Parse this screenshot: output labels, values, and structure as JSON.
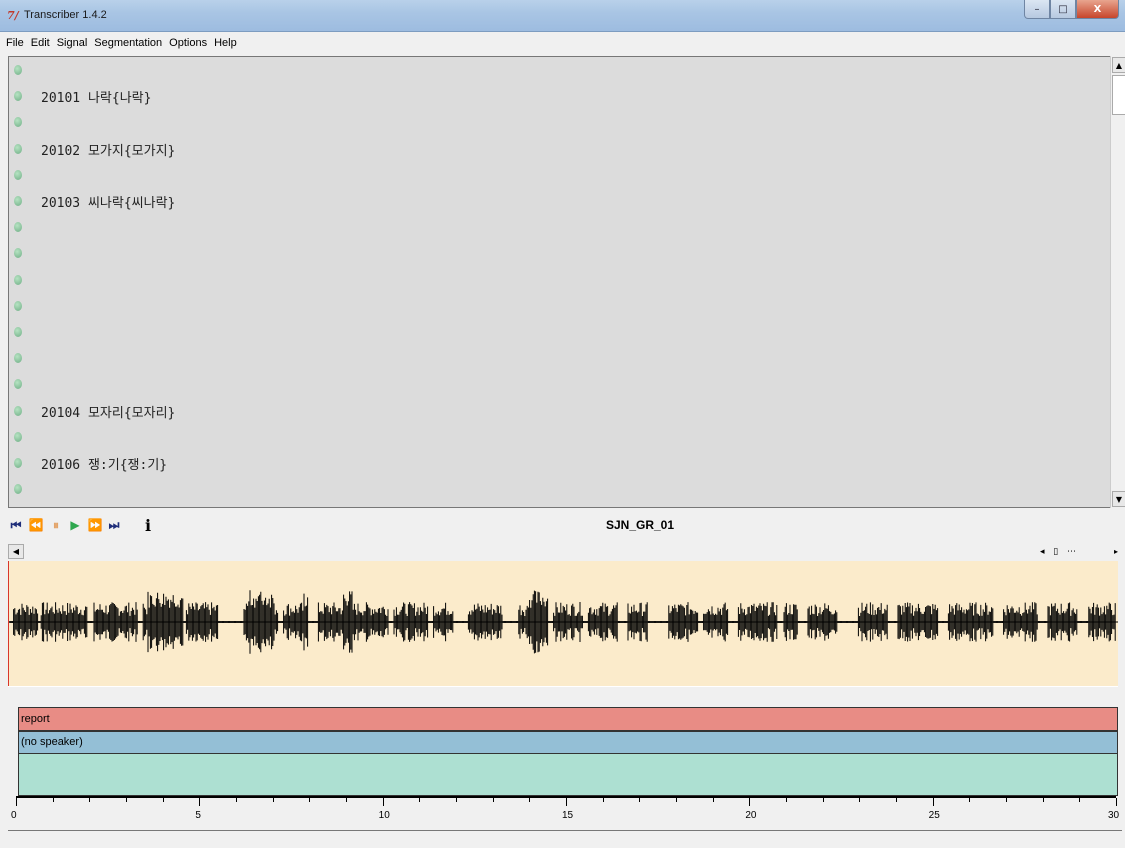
{
  "window": {
    "title": "Transcriber 1.4.2",
    "icon": "tk-icon",
    "minimize": "–",
    "maximize": "□",
    "close": "X"
  },
  "menu": [
    "File",
    "Edit",
    "Signal",
    "Segmentation",
    "Options",
    "Help"
  ],
  "editor": {
    "rows": [
      {
        "text": ""
      },
      {
        "text": "20101 나락{나락}"
      },
      {
        "text": ""
      },
      {
        "text": "20102 모가지{모가지}"
      },
      {
        "text": ""
      },
      {
        "text": "20103 씨나락{씨나락}"
      },
      {
        "text": ""
      },
      {
        "text": ""
      },
      {
        "text": ""
      },
      {
        "text": ""
      },
      {
        "text": ""
      },
      {
        "text": ""
      },
      {
        "text": ""
      },
      {
        "text": "20104 모자리{모자리}"
      },
      {
        "text": ""
      },
      {
        "text": "20106 쟁:기{쟁:기}"
      },
      {
        "text": ""
      }
    ]
  },
  "toolbar": {
    "buttons": [
      {
        "name": "rewind-start-icon",
        "glyph": "⏮"
      },
      {
        "name": "rewind-icon",
        "glyph": "⏪"
      },
      {
        "name": "pause-icon",
        "glyph": "⏸"
      },
      {
        "name": "play-icon",
        "glyph": "▶"
      },
      {
        "name": "fast-forward-icon",
        "glyph": "⏩"
      },
      {
        "name": "skip-end-icon",
        "glyph": "⏭"
      },
      {
        "name": "info-icon",
        "glyph": "i"
      }
    ],
    "file_name": "SJN_GR_01"
  },
  "tracks": {
    "topic": "report",
    "speaker": "(no speaker)"
  },
  "axis": {
    "labels": [
      "0",
      "5",
      "10",
      "15",
      "20",
      "25",
      "30"
    ],
    "max": 30
  },
  "colors": {
    "waveform_bg": "#fbebcb",
    "topic": "#e88c85",
    "speaker": "#94bfd6",
    "segment": "#ade0d2",
    "cursor": "#d9362b"
  }
}
